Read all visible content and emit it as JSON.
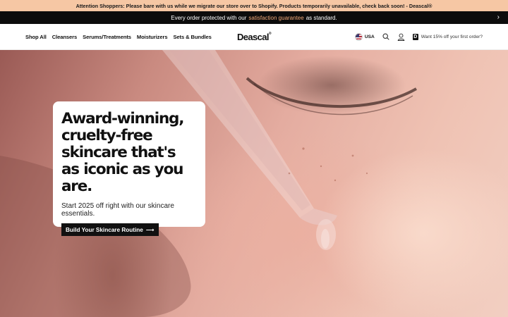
{
  "announcement": {
    "text": "Attention Shoppers: Please bare with us while we migrate our store over to Shopify. Products temporarily unavailable, check back soon! - Deascal®"
  },
  "promo": {
    "text_before": "Every order protected with our",
    "link": "satisfaction guarantee",
    "text_after": "as standard.",
    "arrow": "›"
  },
  "nav": {
    "items": [
      {
        "label": "Shop All"
      },
      {
        "label": "Cleansers"
      },
      {
        "label": "Serums/Treatments"
      },
      {
        "label": "Moisturizers"
      },
      {
        "label": "Sets & Bundles"
      }
    ]
  },
  "logo": {
    "text": "Deascal",
    "mark": "®"
  },
  "header_right": {
    "country": "USA",
    "offer_mark": "D",
    "offer": "Want 15% off your first order?"
  },
  "hero": {
    "headline": "Award-winning, cruelty-free skincare that's as iconic as you are.",
    "subtext": "Start 2025 off right with our skincare essentials.",
    "cta": "Build Your Skincare Routine",
    "cta_arrow": "⟶"
  },
  "colors": {
    "announcement_bg": "#f6c7a4",
    "promo_link": "#f0a878",
    "dark": "#0c0c0c"
  }
}
